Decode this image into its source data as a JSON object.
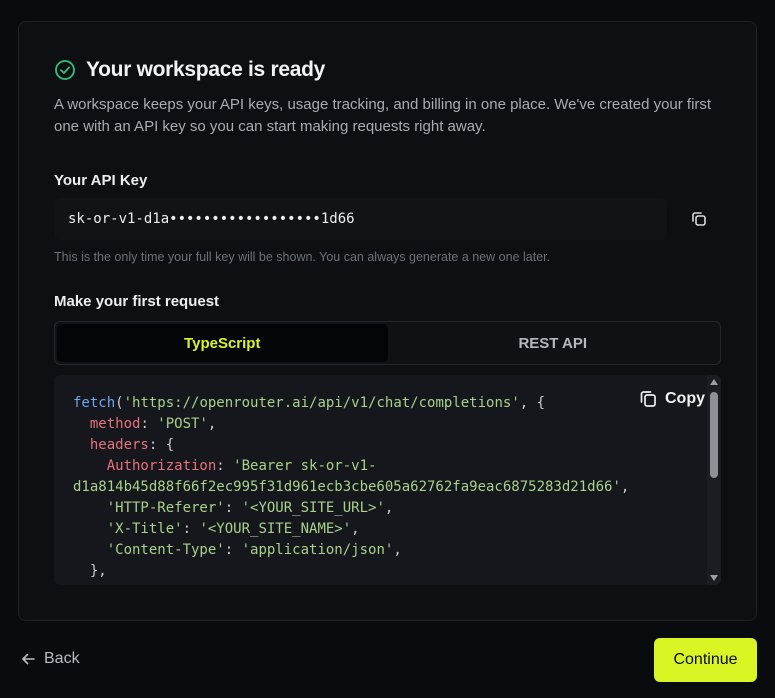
{
  "header": {
    "title": "Your workspace is ready",
    "icon": "check-circle-icon",
    "accent_color": "#2ec27e"
  },
  "intro": "A workspace keeps your API keys, usage tracking, and billing in one place. We've created your first one with an API key so you can start making requests right away.",
  "api_key": {
    "label": "Your API Key",
    "value": "sk-or-v1-d1a••••••••••••••••••1d66",
    "note": "This is the only time your full key will be shown. You can always generate a new one later.",
    "copy_icon": "copy-icon"
  },
  "request": {
    "label": "Make your first request",
    "tabs": [
      {
        "label": "TypeScript",
        "active": true
      },
      {
        "label": "REST API",
        "active": false
      }
    ],
    "copy_label": "Copy",
    "code": {
      "fetch": "fetch",
      "url": "'https://openrouter.ai/api/v1/chat/completions'",
      "method_key": "method",
      "method_val": "'POST'",
      "headers_key": "headers",
      "auth_key": "Authorization",
      "auth_val_1": "'Bearer sk-or-v1-",
      "auth_val_2": "d1a814b45d88f66f2ec995f31d961ecb3cbe605a62762fa9eac6875283d21d66'",
      "referer_key": "'HTTP-Referer'",
      "referer_val": "'<YOUR_SITE_URL>'",
      "xtitle_key": "'X-Title'",
      "xtitle_val": "'<YOUR_SITE_NAME>'",
      "ctype_key": "'Content-Type'",
      "ctype_val": "'application/json'"
    }
  },
  "footer": {
    "back_label": "Back",
    "continue_label": "Continue"
  },
  "colors": {
    "brand": "#d9f523",
    "background": "#090b0e",
    "card": "#0d0f12"
  }
}
